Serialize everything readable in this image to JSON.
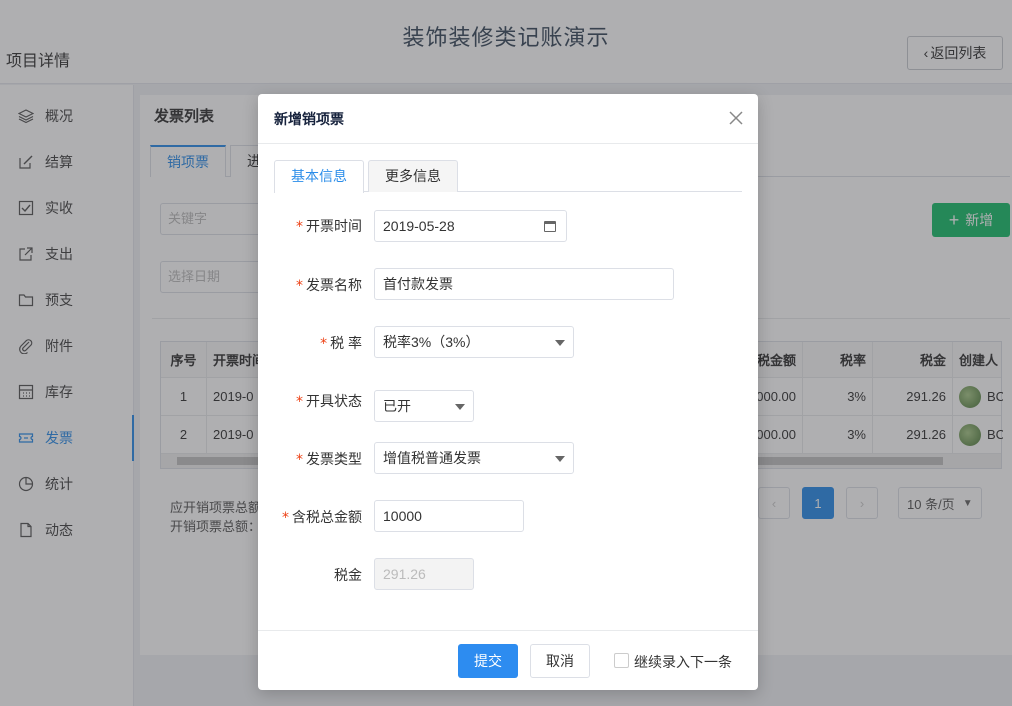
{
  "app": {
    "title": "装饰装修类记账演示",
    "page_title": "项目详情",
    "back_label": "返回列表"
  },
  "sidebar": {
    "items": [
      {
        "label": "概况",
        "icon": "layers-icon"
      },
      {
        "label": "结算",
        "icon": "edit-icon"
      },
      {
        "label": "实收",
        "icon": "check-square-icon"
      },
      {
        "label": "支出",
        "icon": "external-link-icon"
      },
      {
        "label": "预支",
        "icon": "folder-icon"
      },
      {
        "label": "附件",
        "icon": "paperclip-icon"
      },
      {
        "label": "库存",
        "icon": "calculator-icon"
      },
      {
        "label": "发票",
        "icon": "ticket-icon"
      },
      {
        "label": "统计",
        "icon": "pie-chart-icon"
      },
      {
        "label": "动态",
        "icon": "document-icon"
      }
    ],
    "active_index": 7
  },
  "content": {
    "section_title": "发票列表",
    "tabs": [
      "销项票",
      "进"
    ],
    "keyword_placeholder": "关键字",
    "date_placeholder": "选择日期",
    "add_label": "新增",
    "table": {
      "headers": [
        "序号",
        "开票时间",
        "税金额",
        "税率",
        "税金",
        "创建人"
      ],
      "rows": [
        [
          "1",
          "2019-0",
          "000.00",
          "3%",
          "291.26",
          "BC"
        ],
        [
          "2",
          "2019-0",
          "000.00",
          "3%",
          "291.26",
          "BC"
        ]
      ]
    },
    "summary": [
      "应开销项票总额",
      "开销项票总额："
    ],
    "pager": {
      "current": "1",
      "page_size": "10 条/页"
    }
  },
  "modal": {
    "title": "新增销项票",
    "tabs": [
      "基本信息",
      "更多信息"
    ],
    "fields": {
      "date": {
        "label": "开票时间",
        "value": "2019-05-28"
      },
      "name": {
        "label": "发票名称",
        "value": "首付款发票"
      },
      "tax_rate": {
        "label": "税 率",
        "value": "税率3%（3%）"
      },
      "status": {
        "label": "开具状态",
        "value": "已开"
      },
      "type": {
        "label": "发票类型",
        "value": "增值税普通发票"
      },
      "total": {
        "label": "含税总金额",
        "value": "10000"
      },
      "tax": {
        "label": "税金",
        "value": "291.26"
      }
    },
    "submit_label": "提交",
    "cancel_label": "取消",
    "continue_label": "继续录入下一条"
  }
}
